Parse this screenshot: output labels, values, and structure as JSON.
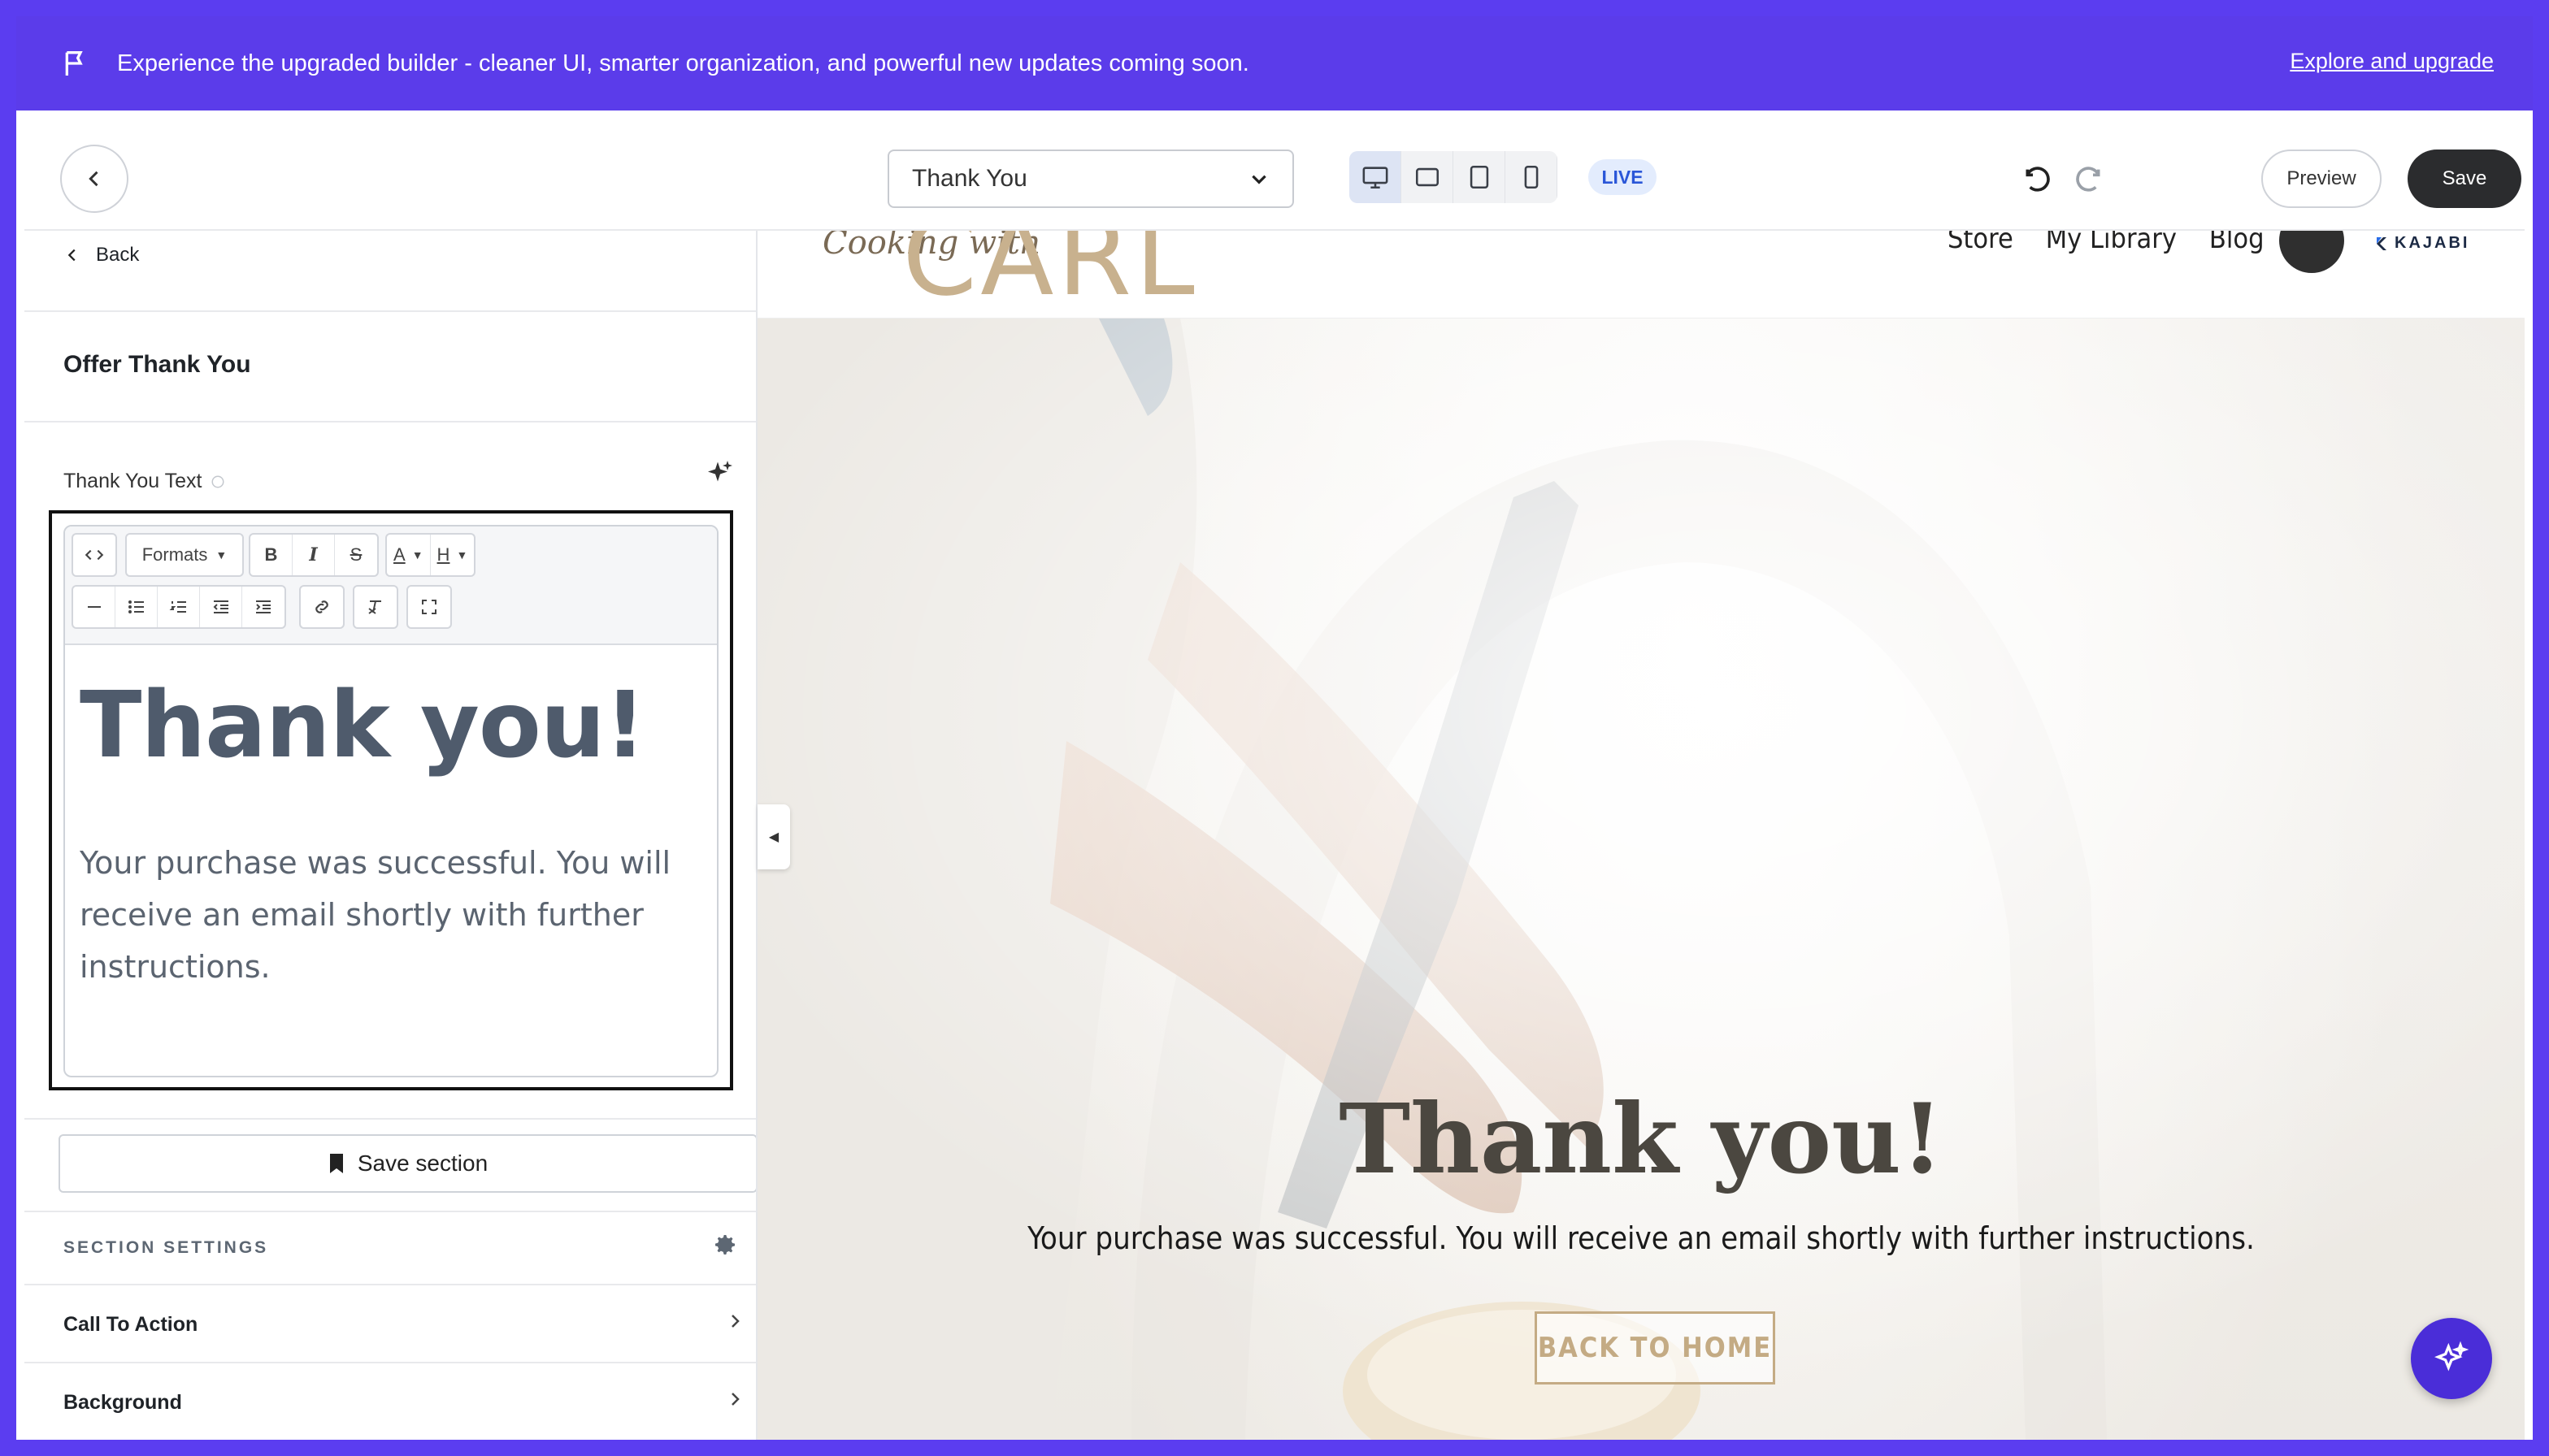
{
  "banner": {
    "message": "Experience the upgraded builder - cleaner UI, smarter organization, and powerful new updates coming soon.",
    "cta": "Explore and upgrade",
    "color": "#5b3cea"
  },
  "toolbar": {
    "page_select": "Thank You",
    "devices": [
      "desktop-icon",
      "tablet-landscape-icon",
      "tablet-portrait-icon",
      "mobile-icon"
    ],
    "status_badge": "LIVE",
    "preview_label": "Preview",
    "save_label": "Save"
  },
  "panel": {
    "back_label": "Back",
    "section_title": "Offer Thank You",
    "field_label": "Thank You Text",
    "editor": {
      "formats_label": "Formats",
      "heading": "Thank you!",
      "body": "Your purchase was successful. You will receive an email shortly with further instructions."
    },
    "save_section_label": "Save section",
    "settings_header": "SECTION SETTINGS",
    "items": [
      {
        "label": "Call To Action"
      },
      {
        "label": "Background"
      }
    ]
  },
  "site": {
    "logo_script": "Cooking with",
    "logo_main": "CARL",
    "nav": [
      "Store",
      "My Library",
      "Blog"
    ],
    "brand": "KAJABI",
    "hero_title": "Thank you!",
    "hero_subtitle": "Your purchase was successful. You will receive an email shortly with further instructions.",
    "hero_button": "BACK TO HOME"
  }
}
